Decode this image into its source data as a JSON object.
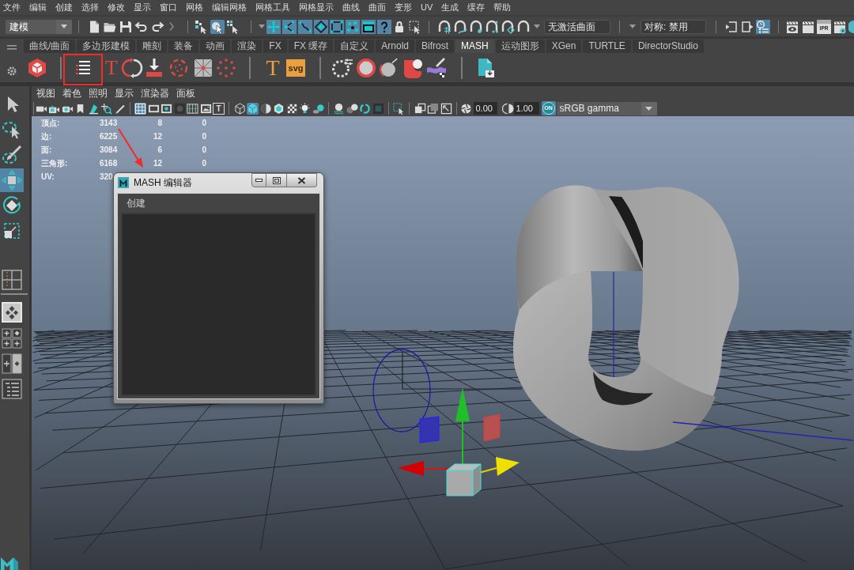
{
  "menu_bar": [
    "文件",
    "编辑",
    "创建",
    "选择",
    "修改",
    "显示",
    "窗口",
    "网格",
    "编辑网格",
    "网格工具",
    "网格显示",
    "曲线",
    "曲面",
    "变形",
    "UV",
    "生成",
    "缓存",
    "帮助"
  ],
  "status_line": {
    "menu_set": "建模",
    "selection_modes": [
      {
        "on": false
      },
      {
        "on": true
      },
      {
        "on": false
      }
    ],
    "selection_masks": [
      {
        "on": true
      },
      {
        "on": true
      },
      {
        "on": true
      },
      {
        "on": true
      },
      {
        "on": true
      },
      {
        "on": true
      },
      {
        "on": true
      },
      {
        "on": true
      }
    ],
    "live_surface": "无激活曲面",
    "symmetry": "对称: 禁用",
    "panel_toggles": [
      {
        "on": false
      },
      {
        "on": false
      },
      {
        "on": true
      }
    ],
    "ipr_label": "IPR"
  },
  "shelf": {
    "tabs": [
      {
        "label": "曲线/曲面",
        "selected": false
      },
      {
        "label": "多边形建模",
        "selected": false
      },
      {
        "label": "雕刻",
        "selected": false
      },
      {
        "label": "装备",
        "selected": false
      },
      {
        "label": "动画",
        "selected": false
      },
      {
        "label": "渲染",
        "selected": false
      },
      {
        "label": "FX",
        "selected": false
      },
      {
        "label": "FX 缓存",
        "selected": false
      },
      {
        "label": "自定义",
        "selected": false
      },
      {
        "label": "Arnold",
        "selected": false
      },
      {
        "label": "Bifrost",
        "selected": false
      },
      {
        "label": "MASH",
        "selected": true
      },
      {
        "label": "运动图形",
        "selected": false
      },
      {
        "label": "XGen",
        "selected": false
      },
      {
        "label": "TURTLE",
        "selected": false
      },
      {
        "label": "DirectorStudio",
        "selected": false
      }
    ],
    "button_labels": [
      "T",
      "T",
      "svg"
    ]
  },
  "tool_box": {
    "tools": [
      {
        "selected": false
      },
      {
        "selected": false
      },
      {
        "selected": false
      },
      {
        "selected": true
      },
      {
        "selected": false
      },
      {
        "selected": false
      }
    ],
    "layouts": [
      {
        "selected": true
      },
      {
        "selected": false
      },
      {
        "selected": false
      },
      {
        "selected": false
      }
    ]
  },
  "viewport": {
    "menu": [
      "视图",
      "着色",
      "照明",
      "显示",
      "渲染器",
      "面板"
    ],
    "toolbar": {
      "buttons": [
        {
          "kind": "icon",
          "on": false
        },
        {
          "kind": "icon",
          "on": false
        },
        {
          "kind": "icon",
          "on": false
        },
        {
          "kind": "icon",
          "on": false
        },
        {
          "kind": "icon",
          "on": false
        },
        {
          "kind": "icon",
          "on": false
        },
        {
          "kind": "icon",
          "on": false
        },
        {
          "kind": "icon",
          "on": true
        },
        {
          "kind": "icon",
          "on": false
        },
        {
          "kind": "icon",
          "on": false
        },
        {
          "kind": "icon",
          "on": false
        },
        {
          "kind": "icon",
          "on": false
        },
        {
          "kind": "icon",
          "on": false
        },
        {
          "kind": "text",
          "label": "T",
          "on": false
        },
        {
          "kind": "icon",
          "on": false
        },
        {
          "kind": "icon",
          "on": true
        },
        {
          "kind": "icon",
          "on": false
        },
        {
          "kind": "icon",
          "on": false
        },
        {
          "kind": "icon",
          "on": false
        },
        {
          "kind": "icon",
          "on": false
        },
        {
          "kind": "icon",
          "on": false
        },
        {
          "kind": "icon",
          "on": false
        },
        {
          "kind": "icon",
          "on": false
        },
        {
          "kind": "icon",
          "on": false
        },
        {
          "kind": "icon",
          "on": false
        },
        {
          "kind": "icon",
          "on": false
        },
        {
          "kind": "icon",
          "on": false
        },
        {
          "kind": "icon",
          "on": false
        },
        {
          "kind": "icon",
          "on": false
        }
      ],
      "exposure": "0.00",
      "gamma": "1.00",
      "color_management": {
        "label": "ON",
        "on": true
      },
      "view_transform": "sRGB gamma"
    },
    "hud": [
      {
        "label": "顶点:",
        "values": [
          "3143",
          "8",
          "0"
        ]
      },
      {
        "label": "边:",
        "values": [
          "6225",
          "12",
          "0"
        ]
      },
      {
        "label": "面:",
        "values": [
          "3084",
          "6",
          "0"
        ]
      },
      {
        "label": "三角形:",
        "values": [
          "6168",
          "12",
          "0"
        ]
      },
      {
        "label": "UV:",
        "values": [
          "320"
        ]
      }
    ]
  },
  "mash_editor": {
    "title": "MASH 编辑器",
    "menu": [
      "创建"
    ]
  }
}
